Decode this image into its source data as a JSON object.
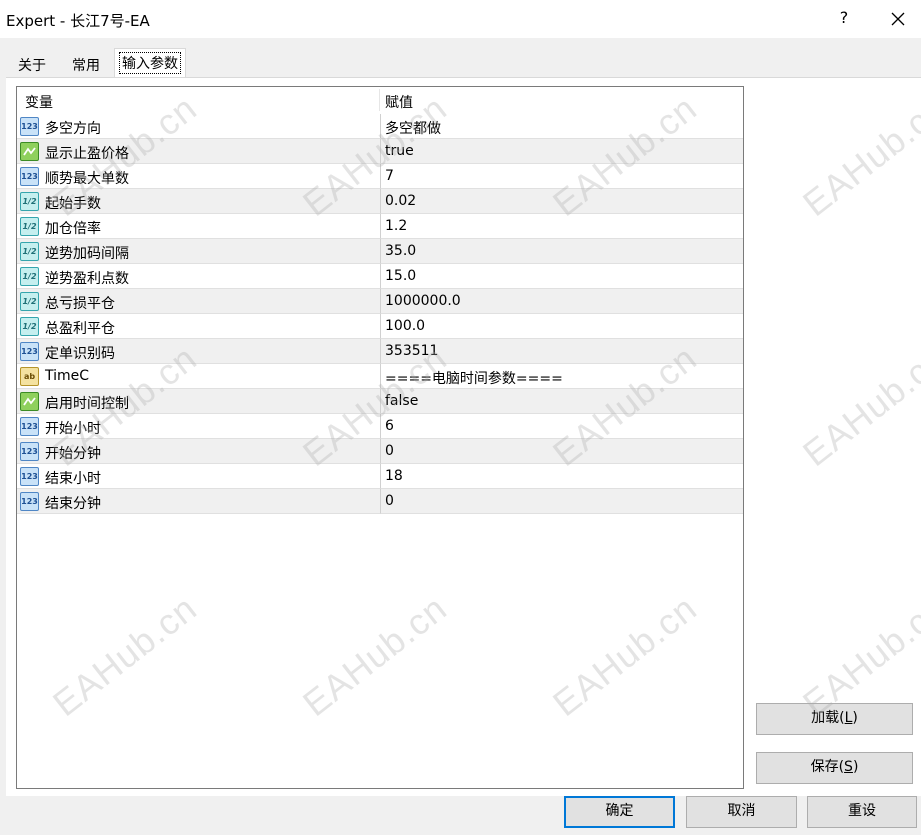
{
  "window": {
    "title": "Expert - 长江7号-EA",
    "help_glyph": "?"
  },
  "tabs": [
    {
      "label": "关于"
    },
    {
      "label": "常用"
    },
    {
      "label": "输入参数"
    }
  ],
  "grid": {
    "headers": {
      "variable": "变量",
      "value": "赋值"
    },
    "rows": [
      {
        "type": "int",
        "name": "多空方向",
        "value": "多空都做"
      },
      {
        "type": "bool",
        "name": "显示止盈价格",
        "value": "true"
      },
      {
        "type": "int",
        "name": "顺势最大单数",
        "value": "7"
      },
      {
        "type": "double",
        "name": "起始手数",
        "value": "0.02"
      },
      {
        "type": "double",
        "name": "加仓倍率",
        "value": "1.2"
      },
      {
        "type": "double",
        "name": "逆势加码间隔",
        "value": "35.0"
      },
      {
        "type": "double",
        "name": "逆势盈利点数",
        "value": "15.0"
      },
      {
        "type": "double",
        "name": "总亏损平仓",
        "value": "1000000.0"
      },
      {
        "type": "double",
        "name": "总盈利平仓",
        "value": "100.0"
      },
      {
        "type": "int",
        "name": "定单识别码",
        "value": "353511"
      },
      {
        "type": "string",
        "name": "TimeC",
        "value": "====电脑时间参数===="
      },
      {
        "type": "bool",
        "name": "启用时间控制",
        "value": "false"
      },
      {
        "type": "int",
        "name": "开始小时",
        "value": "6"
      },
      {
        "type": "int",
        "name": "开始分钟",
        "value": "0"
      },
      {
        "type": "int",
        "name": "结束小时",
        "value": "18"
      },
      {
        "type": "int",
        "name": "结束分钟",
        "value": "0"
      }
    ]
  },
  "icons": {
    "int": "123",
    "double": "1/2",
    "string": "ab"
  },
  "buttons": {
    "load": {
      "label": "加载(",
      "key": "L",
      "end": ")"
    },
    "save": {
      "label": "保存(",
      "key": "S",
      "end": ")"
    },
    "ok": "确定",
    "cancel": "取消",
    "reset": "重设"
  },
  "watermark": "EAHub.cn"
}
